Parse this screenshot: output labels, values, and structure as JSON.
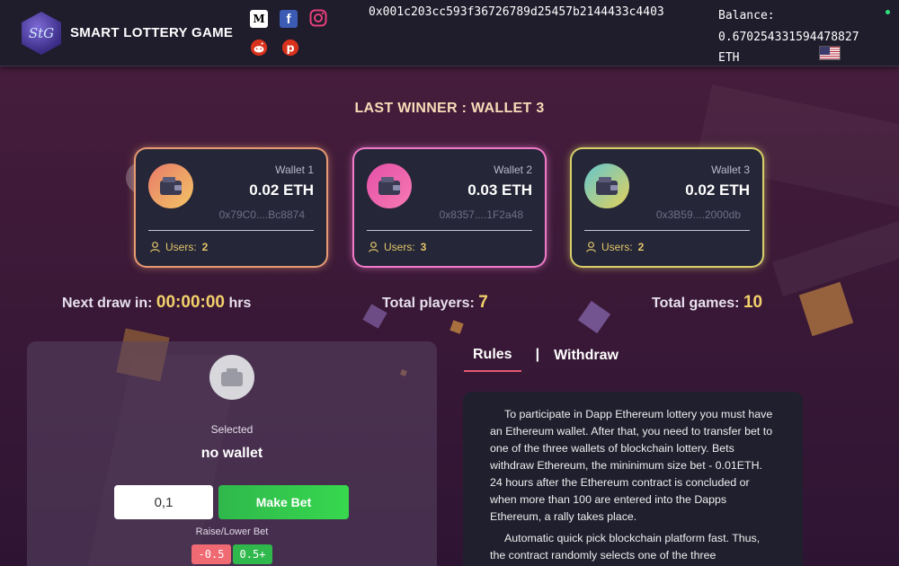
{
  "header": {
    "logo_text": "StG",
    "app_title": "SMART LOTTERY GAME",
    "social": [
      "medium-icon",
      "facebook-icon",
      "instagram-icon",
      "reddit-icon",
      "pinterest-icon"
    ],
    "wallet_address": "0x001c203cc593f36726789d25457b2144433c4403",
    "balance_label": "Balance:",
    "balance_value": "0.670254331594478827",
    "balance_unit": "ETH",
    "language_flag": "us-flag-icon"
  },
  "last_winner": "LAST WINNER : WALLET 3",
  "wallets": [
    {
      "name": "Wallet 1",
      "amount": "0.02 ETH",
      "address": "0x79C0....Bc8874",
      "users_label": "Users:",
      "users": "2",
      "icon_colors": [
        "#e87a6a",
        "#f3c564"
      ],
      "glow": "#f0a07a"
    },
    {
      "name": "Wallet 2",
      "amount": "0.03 ETH",
      "address": "0x8357....1F2a48",
      "users_label": "Users:",
      "users": "3",
      "icon_colors": [
        "#e450a8",
        "#f77ab2"
      ],
      "glow": "#f07ac8"
    },
    {
      "name": "Wallet 3",
      "amount": "0.02 ETH",
      "address": "0x3B59....2000db",
      "users_label": "Users:",
      "users": "2",
      "icon_colors": [
        "#63c6ce",
        "#e4d15a"
      ],
      "glow": "#e2d66a"
    }
  ],
  "stats": {
    "next_draw_label": "Next draw in:",
    "next_draw_value": "00:00:00",
    "next_draw_unit": "hrs",
    "total_players_label": "Total players:",
    "total_players_value": "7",
    "total_games_label": "Total games:",
    "total_games_value": "10"
  },
  "bet": {
    "selected_label": "Selected",
    "selected_value": "no wallet",
    "amount_value": "0,1",
    "make_bet_label": "Make Bet",
    "raise_label": "Raise/Lower Bet",
    "lower_label": "-0.5",
    "raise_btn_label": "0.5+"
  },
  "tabs": {
    "rules": "Rules",
    "separator": "|",
    "withdraw": "Withdraw"
  },
  "rules": {
    "p1": "To participate in Dapp Ethereum lottery you must have an Ethereum wallet. After that, you need to transfer bet to one of the three wallets of blockchain lottery. Bets withdraw Ethereum, the mininimum size bet - 0.01ETH. 24 hours after the Ethereum contract is concluded or when more than 100 are entered into the Dapps Ethereum, a rally takes place.",
    "p2": "Automatic quick pick blockchain platform fast. Thus, the contract randomly selects one of the three"
  }
}
